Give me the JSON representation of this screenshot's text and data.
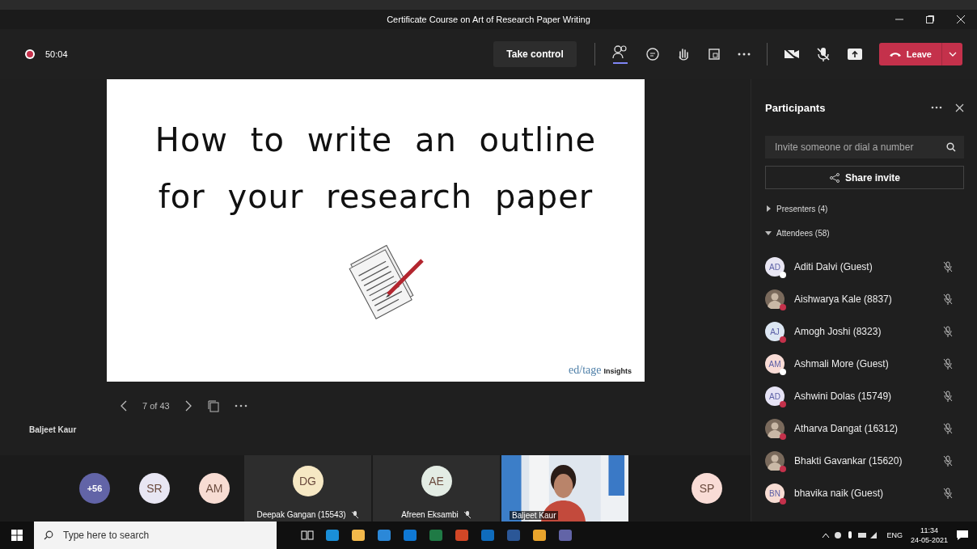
{
  "window": {
    "title": "Certificate Course on Art of Research Paper Writing"
  },
  "toolbar": {
    "recording": true,
    "timer": "50:04",
    "take_control": "Take control",
    "leave": "Leave",
    "participants_selected": true
  },
  "slide": {
    "title_lines": [
      "How to write an outline",
      "for your research paper"
    ],
    "logo_main": "ed/tage",
    "logo_sub": "Insights",
    "page": "7 of 43"
  },
  "presenter_name": "Baljeet Kaur",
  "stage": [
    {
      "kind": "overflow",
      "label": "+56",
      "color": "#6264a7"
    },
    {
      "kind": "avatar",
      "label": "SR",
      "color": "#e8e6f3"
    },
    {
      "kind": "avatar",
      "label": "AM",
      "color": "#f7dcd3"
    },
    {
      "kind": "tile",
      "label": "DG",
      "color": "#f6e8c4",
      "name": "Deepak Gangan (15543)",
      "muted": true
    },
    {
      "kind": "tile",
      "label": "AE",
      "color": "#e3ece4",
      "name": "Afreen Eksambi",
      "muted": true
    },
    {
      "kind": "video",
      "name": "Baljeet Kaur"
    },
    {
      "kind": "avatar",
      "label": "SP",
      "color": "#f9dcd6"
    }
  ],
  "participants": {
    "title": "Participants",
    "search": {
      "placeholder": "Invite someone or dial a number"
    },
    "share_invite": "Share invite",
    "groups": [
      {
        "label": "Presenters (4)",
        "expanded": false
      },
      {
        "label": "Attendees (58)",
        "expanded": true
      }
    ],
    "people": [
      {
        "kind": "initials",
        "initials": "AD",
        "name": "Aditi Dalvi (Guest)",
        "color": "#ffffff"
      },
      {
        "name": "Aishwarya Kale (8837)",
        "color": "#c4314b"
      },
      {
        "kind": "initials",
        "initials": "AJ",
        "name": "Amogh Joshi (8323)",
        "color": "#c4314b"
      },
      {
        "kind": "initials",
        "initials": "AM",
        "name": "Ashmali More (Guest)",
        "color": "#ffffff"
      },
      {
        "kind": "initials",
        "initials": "AD",
        "name": "Ashwini Dolas (15749)",
        "color": "#c4314b"
      },
      {
        "name": "Atharva Dangat (16312)",
        "color": "#c4314b"
      },
      {
        "name": "Bhakti Gavankar (15620)",
        "color": "#c4314b"
      },
      {
        "kind": "initials",
        "initials": "BN",
        "name": "bhavika naik (Guest)",
        "color": "#c4314b"
      }
    ]
  },
  "taskbar": {
    "search_placeholder": "Type here to search",
    "language": "ENG",
    "time": "11:34",
    "date": "24-05-2021"
  }
}
